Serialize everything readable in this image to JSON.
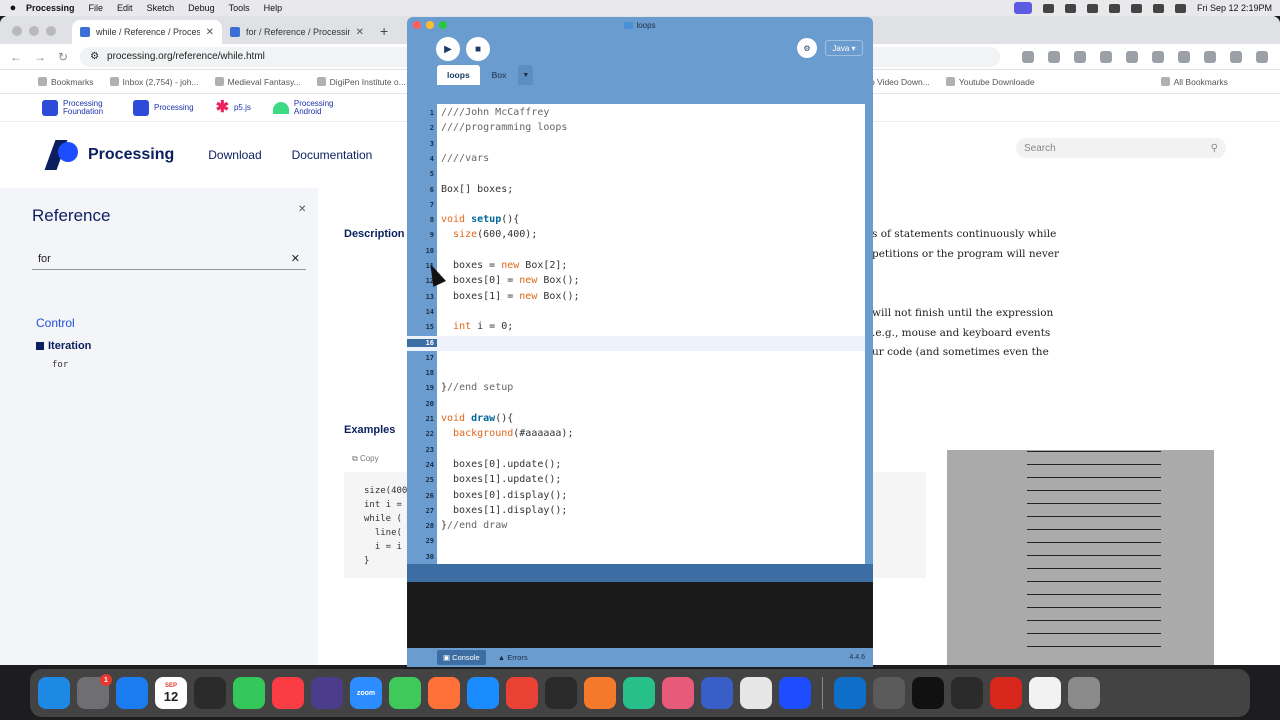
{
  "menubar": {
    "app": "Processing",
    "items": [
      "File",
      "Edit",
      "Sketch",
      "Debug",
      "Tools",
      "Help"
    ],
    "datetime": "Fri Sep 12  2:19PM"
  },
  "browser": {
    "tabs": [
      {
        "label": "while / Reference / Processing.o"
      },
      {
        "label": "for / Reference / Processing.o"
      }
    ],
    "url": "processing.org/reference/while.html",
    "bookmarks": [
      "Bookmarks",
      "Inbox (2,754) - joh...",
      "Medieval Fantasy...",
      "DigiPen Institute o...",
      "Vimeo Video Down...",
      "Youtube Downloade",
      "All Bookmarks"
    ]
  },
  "site": {
    "topbar": [
      "Processing Foundation",
      "Processing",
      "p5.js",
      "Processing Android"
    ],
    "brand": "Processing",
    "nav": [
      "Download",
      "Documentation"
    ],
    "search_placeholder": "Search",
    "sidebar": {
      "title": "Reference",
      "filter_value": "for",
      "section": "Control",
      "group": "Iteration",
      "item": "for"
    },
    "headings": {
      "description": "Description",
      "examples": "Examples"
    },
    "description_lines": [
      "s of statements continuously while",
      "petitions or the program will never",
      "will not finish until the expression",
      ".e.g., mouse and keyboard events",
      "ur code (and sometimes even the"
    ],
    "copy_label": "Copy",
    "example_code": [
      "size(400",
      "int i =",
      "while (",
      "  line(",
      "  i = i",
      "}"
    ]
  },
  "ide": {
    "title": "loops",
    "mode": "Java ▾",
    "tabs": [
      "loops",
      "Box"
    ],
    "code_lines": [
      "////John McCaffrey",
      "////programming loops",
      "",
      "////vars",
      "",
      "Box[] boxes;",
      "",
      "void setup(){",
      "  size(600,400);",
      "",
      "  boxes = new Box[2];",
      "  boxes[0] = new Box();",
      "  boxes[1] = new Box();",
      "",
      "  int i = 0;",
      "",
      "",
      "",
      "}//end setup",
      "",
      "void draw(){",
      "  background(#aaaaaa);",
      "",
      "  boxes[0].update();",
      "  boxes[1].update();",
      "  boxes[0].display();",
      "  boxes[1].display();",
      "}//end draw",
      "",
      ""
    ],
    "current_line": 16,
    "console_tabs": [
      "Console",
      "Errors"
    ],
    "version": "4.4.6"
  },
  "dock": {
    "apps": [
      "finder-icon",
      "settings-icon",
      "app-store-icon",
      "calendar-icon",
      "xd-pen-icon",
      "messages-icon",
      "music-icon",
      "bbedit-icon",
      "zoom-icon",
      "numbers-icon",
      "firefox-icon",
      "safari-icon",
      "chrome-icon",
      "davinci-icon",
      "blender-icon",
      "h-icon",
      "s-icon",
      "files-icon",
      "link-icon",
      "processing-icon",
      "vscode-icon",
      "calculator-icon",
      "terminal-icon",
      "xd-pen-icon-2",
      "acrobat-icon",
      "document-icon",
      "trash-icon"
    ],
    "calendar_month": "SEP",
    "calendar_day": "12",
    "settings_badge": "1",
    "zoom_label": "zoom"
  }
}
